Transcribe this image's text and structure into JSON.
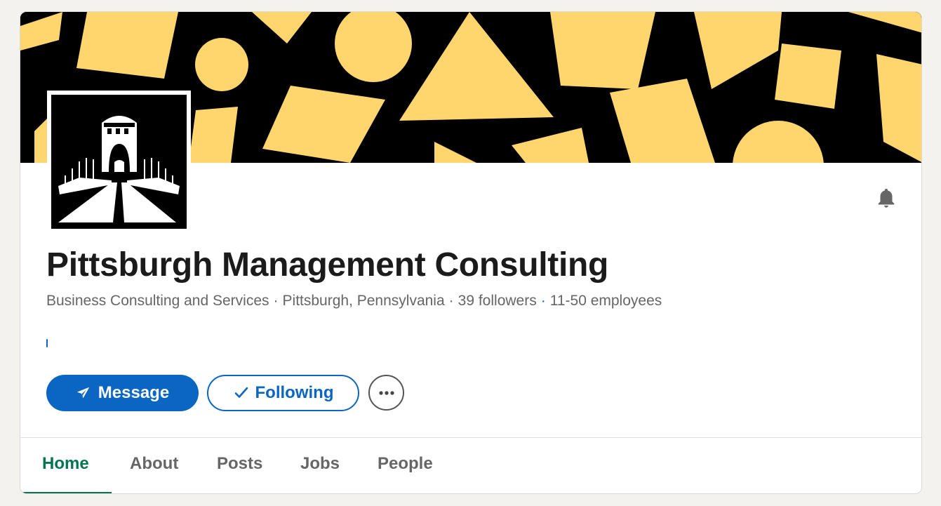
{
  "company": {
    "name": "Pittsburgh Management Consulting",
    "industry": "Business Consulting and Services",
    "location": "Pittsburgh, Pennsylvania",
    "followers": "39 followers",
    "employees": "11-50 employees"
  },
  "actions": {
    "message_label": "Message",
    "following_label": "Following"
  },
  "icons": {
    "bell": "bell-icon",
    "message": "send-icon",
    "following": "check-icon",
    "more": "ellipsis-icon"
  },
  "tabs": [
    {
      "label": "Home",
      "active": true
    },
    {
      "label": "About",
      "active": false
    },
    {
      "label": "Posts",
      "active": false
    },
    {
      "label": "Jobs",
      "active": false
    },
    {
      "label": "People",
      "active": false
    }
  ],
  "colors": {
    "primary_blue": "#0a66c2",
    "active_tab_green": "#01754f",
    "banner_yellow": "#ffd66e",
    "banner_black": "#000000"
  }
}
